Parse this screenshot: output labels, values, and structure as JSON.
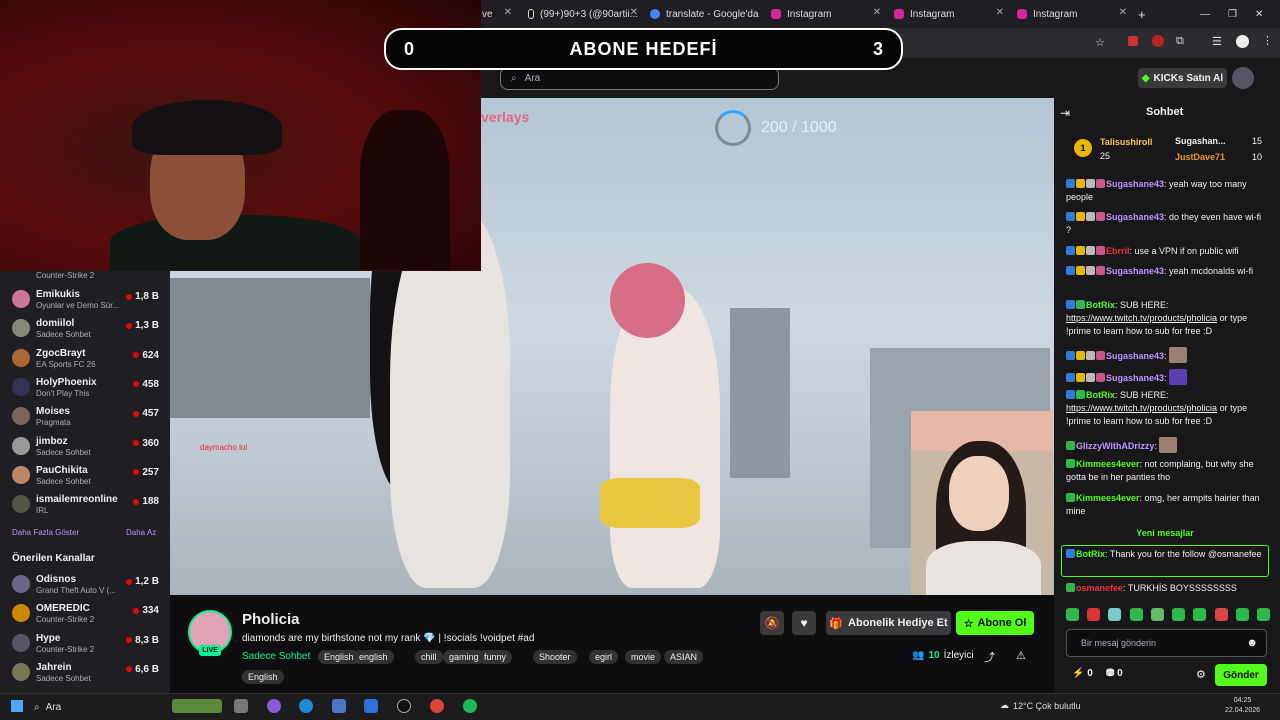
{
  "browser": {
    "tabs": [
      {
        "label": "ve",
        "icon": "tab-icon"
      },
      {
        "label": "(99+)90+3 (@90artii...",
        "icon": "tiktok-icon"
      },
      {
        "label": "translate - Google'da",
        "icon": "google-icon"
      },
      {
        "label": "Instagram",
        "icon": "instagram-icon"
      },
      {
        "label": "Instagram",
        "icon": "instagram-icon"
      },
      {
        "label": "Instagram",
        "icon": "instagram-icon"
      }
    ],
    "new_tab": "+"
  },
  "overlay": {
    "left_count": "0",
    "title": "ABONE HEDEFİ",
    "right_count": "3"
  },
  "header": {
    "search_placeholder": "Ara",
    "kicks_label": "KICKs Satın Al"
  },
  "video": {
    "goal_text": "200 / 1000",
    "overlays_text": "verlays",
    "in_video_chat": "daymacho lol"
  },
  "sidebar": {
    "first_partial_game": "Counter-Strike 2",
    "channels": [
      {
        "name": "Emikukis",
        "game": "Oyunlar ve Demo Sür...",
        "viewers": "1,8 B",
        "color": "#c79"
      },
      {
        "name": "domiilol",
        "game": "Sadece Sohbet",
        "viewers": "1,3 B",
        "color": "#887"
      },
      {
        "name": "ZgocBrayt",
        "game": "EA Sports FC 26",
        "viewers": "624",
        "color": "#a63"
      },
      {
        "name": "HolyPhoenix",
        "game": "Don't Play This",
        "viewers": "458",
        "color": "#335"
      },
      {
        "name": "Moises",
        "game": "Pragmata",
        "viewers": "457",
        "color": "#765"
      },
      {
        "name": "jimboz",
        "game": "Sadece Sohbet",
        "viewers": "360",
        "color": "#999"
      },
      {
        "name": "PauChikita",
        "game": "Sadece Sohbet",
        "viewers": "257",
        "color": "#b86"
      },
      {
        "name": "ismailemreonline",
        "game": "IRL",
        "viewers": "188",
        "color": "#554"
      }
    ],
    "show_more": "Daha Fazla Göster",
    "show_less": "Daha Az",
    "recommended_title": "Önerilen Kanallar",
    "recommended": [
      {
        "name": "Odisnos",
        "game": "Grand Theft Auto V (...",
        "viewers": "1,2 B",
        "color": "#668"
      },
      {
        "name": "OMEREDIC",
        "game": "Counter-Strike 2",
        "viewers": "334",
        "color": "#c80"
      },
      {
        "name": "Hype",
        "game": "Counter-Strike 2",
        "viewers": "8,3 B",
        "color": "#556"
      },
      {
        "name": "Jahrein",
        "game": "Sadece Sohbet",
        "viewers": "6,6 B",
        "color": "#775"
      }
    ]
  },
  "stream": {
    "name": "Pholicia",
    "live": "LIVE",
    "title": "diamonds are my birthstone not my rank 💎 | !socials !voidpet #ad",
    "category": "Sadece Sohbet",
    "tags": [
      "English",
      "english",
      "chill",
      "gaming",
      "funny",
      "Shooter",
      "egirl",
      "movie",
      "ASIAN",
      "English"
    ],
    "viewer_count": "10",
    "viewer_label": "İzleyici",
    "gift_label": "Abonelik Hediye Et",
    "sub_label": "Abone Ol"
  },
  "chat": {
    "title": "Sohbet",
    "leaderboard": [
      {
        "name": "Talisushiroll",
        "count": "25"
      },
      {
        "name": "Sugashan...",
        "count": "15"
      },
      {
        "name": "JustDave71",
        "count": "10"
      }
    ],
    "messages": [
      {
        "user": "Sugashane43",
        "color": "#bf94ff",
        "text": ": yeah way too many people"
      },
      {
        "user": "Sugashane43",
        "color": "#bf94ff",
        "text": ": do they even have wi-fi ?"
      },
      {
        "user": "Ebrril",
        "color": "#e34",
        "text": ": use a VPN if on public wifi"
      },
      {
        "user": "Sugashane43",
        "color": "#bf94ff",
        "text": ": yeah mcdonalds wi-fi"
      },
      {
        "user": "BotRix",
        "color": "#53fc18",
        "text": ": SUB HERE:",
        "link": "https://www.twitch.tv/products/pholicia",
        "after": " or type !prime to learn how to sub for free :D"
      },
      {
        "user": "Sugashane43",
        "color": "#bf94ff",
        "text": ":"
      },
      {
        "user": "Sugashane43",
        "color": "#bf94ff",
        "text": ":"
      },
      {
        "user": "BotRix",
        "color": "#53fc18",
        "text": ": SUB HERE:",
        "link": "https://www.twitch.tv/products/pholicia",
        "after": " or type !prime to learn how to sub for free :D"
      },
      {
        "user": "GlizzyWithADrizzy",
        "color": "#bf94ff",
        "text": ":"
      },
      {
        "user": "Kimmees4ever",
        "color": "#53fc18",
        "text": ": not complaing, but why she gotta be in her panties tho"
      },
      {
        "user": "Kimmees4ever",
        "color": "#53fc18",
        "text": ": omg, her armpits hairier than mine"
      }
    ],
    "new_messages": "Yeni mesajlar",
    "highlight": {
      "user": "BotRix",
      "text": ": Thank you for the follow @osmanefee"
    },
    "last": {
      "user": "osmanefee",
      "text": ": TURKHİS BOYSSSSSSSS"
    },
    "input_placeholder": "Bir mesaj gönderin",
    "points_a": "0",
    "points_b": "0",
    "send_label": "Gönder"
  },
  "taskbar": {
    "search": "Ara",
    "weather": "12°C  Çok bulutlu",
    "time": "04:25",
    "date": "22.04.2026"
  }
}
